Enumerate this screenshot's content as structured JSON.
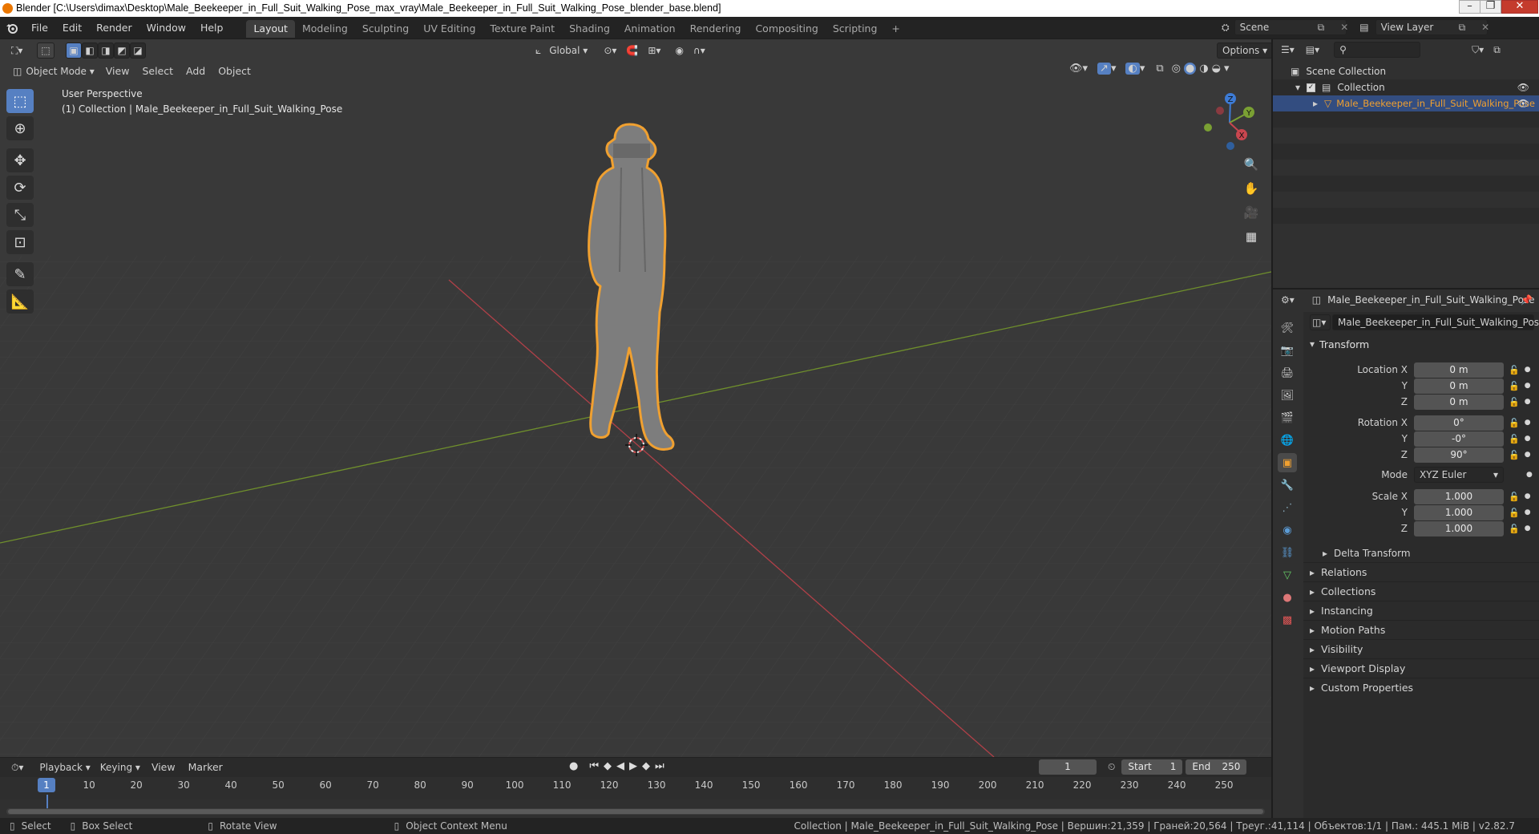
{
  "window": {
    "title": "Blender [C:\\Users\\dimax\\Desktop\\Male_Beekeeper_in_Full_Suit_Walking_Pose_max_vray\\Male_Beekeeper_in_Full_Suit_Walking_Pose_blender_base.blend]"
  },
  "menu": [
    "File",
    "Edit",
    "Render",
    "Window",
    "Help"
  ],
  "workspaces": [
    "Layout",
    "Modeling",
    "Sculpting",
    "UV Editing",
    "Texture Paint",
    "Shading",
    "Animation",
    "Rendering",
    "Compositing",
    "Scripting"
  ],
  "workspace_add": "+",
  "scene": {
    "name": "Scene",
    "view_layer": "View Layer"
  },
  "viewport": {
    "transform_orientation": "Global",
    "options_label": "Options",
    "mode": "Object Mode",
    "menus": [
      "View",
      "Select",
      "Add",
      "Object"
    ],
    "overlay_line1": "User Perspective",
    "overlay_line2": "(1) Collection | Male_Beekeeper_in_Full_Suit_Walking_Pose",
    "gizmo": {
      "x": "X",
      "y": "Y",
      "z": "Z"
    }
  },
  "outliner": {
    "root": "Scene Collection",
    "collection": "Collection",
    "object": "Male_Beekeeper_in_Full_Suit_Walking_Pose"
  },
  "properties": {
    "object_name": "Male_Beekeeper_in_Full_Suit_Walking_Pose",
    "data_name": "Male_Beekeeper_in_Full_Suit_Walking_Pose",
    "transform_title": "Transform",
    "location_label": "Location X",
    "rotation_label": "Rotation X",
    "scale_label": "Scale X",
    "y_label": "Y",
    "z_label": "Z",
    "location": [
      "0 m",
      "0 m",
      "0 m"
    ],
    "rotation": [
      "0°",
      "-0°",
      "90°"
    ],
    "mode_label": "Mode",
    "mode_value": "XYZ Euler",
    "scale": [
      "1.000",
      "1.000",
      "1.000"
    ],
    "delta_transform": "Delta Transform",
    "panels": [
      "Relations",
      "Collections",
      "Instancing",
      "Motion Paths",
      "Visibility",
      "Viewport Display",
      "Custom Properties"
    ]
  },
  "timeline": {
    "menus": [
      "Playback",
      "Keying",
      "View",
      "Marker"
    ],
    "current_frame": "1",
    "start_label": "Start",
    "start": "1",
    "end_label": "End",
    "end": "250",
    "ticks": [
      "1",
      "10",
      "20",
      "30",
      "40",
      "50",
      "60",
      "70",
      "80",
      "90",
      "100",
      "110",
      "120",
      "130",
      "140",
      "150",
      "160",
      "170",
      "180",
      "190",
      "200",
      "210",
      "220",
      "230",
      "240",
      "250"
    ]
  },
  "statusbar": {
    "select": "Select",
    "box_select": "Box Select",
    "rotate_view": "Rotate View",
    "context_menu": "Object Context Menu",
    "stats": "Collection | Male_Beekeeper_in_Full_Suit_Walking_Pose | Вершин:21,359 | Граней:20,564 | Треуг.:41,114 | Объектов:1/1 | Пам.: 445.1 MiB | v2.82.7"
  },
  "colors": {
    "accent": "#5680c2",
    "selection_outline": "#f0a030",
    "x_axis": "#c8464f",
    "y_axis": "#7aa033",
    "z_axis": "#3d7bd5"
  }
}
